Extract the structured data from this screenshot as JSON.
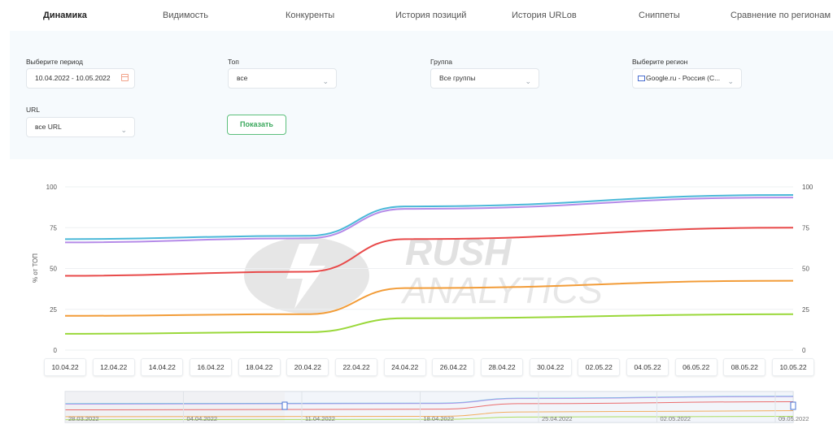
{
  "tabs": [
    {
      "label": "Динамика",
      "active": true
    },
    {
      "label": "Видимость"
    },
    {
      "label": "Конкуренты"
    },
    {
      "label": "История позиций"
    },
    {
      "label": "История URLов"
    },
    {
      "label": "Сниппеты"
    },
    {
      "label": "Сравнение по регионам"
    }
  ],
  "filters": {
    "period": {
      "label": "Выберите период",
      "value": "10.04.2022 - 10.05.2022"
    },
    "top": {
      "label": "Топ",
      "value": "все"
    },
    "group": {
      "label": "Группа",
      "value": "Все группы"
    },
    "region": {
      "label": "Выберите регион",
      "value": "Google.ru - Россия (С..."
    },
    "url": {
      "label": "URL",
      "value": "все URL"
    },
    "show_button": "Показать"
  },
  "watermark": {
    "line1": "RUSH",
    "line2": "ANALYTICS"
  },
  "chart_data": {
    "type": "line",
    "ylabel": "% от ТОП",
    "ylim": [
      0,
      100
    ],
    "yticks": [
      0,
      25,
      50,
      75,
      100
    ],
    "x": [
      "10.04.22",
      "12.04.22",
      "14.04.22",
      "16.04.22",
      "18.04.22",
      "20.04.22",
      "22.04.22",
      "24.04.22",
      "26.04.22",
      "28.04.22",
      "30.04.22",
      "02.05.22",
      "04.05.22",
      "06.05.22",
      "08.05.22",
      "10.05.22"
    ],
    "series": [
      {
        "color": "#4ab8d8",
        "points": [
          [
            "10.04.22",
            68
          ],
          [
            "20.04.22",
            70
          ],
          [
            "24.04.22",
            88
          ],
          [
            "10.05.22",
            95
          ]
        ]
      },
      {
        "color": "#b58be8",
        "points": [
          [
            "10.04.22",
            66
          ],
          [
            "20.04.22",
            68.5
          ],
          [
            "24.04.22",
            86.5
          ],
          [
            "10.05.22",
            93.5
          ]
        ]
      },
      {
        "color": "#e84a4a",
        "points": [
          [
            "10.04.22",
            45.5
          ],
          [
            "20.04.22",
            48
          ],
          [
            "24.04.22",
            68
          ],
          [
            "10.05.22",
            75
          ]
        ]
      },
      {
        "color": "#f29c38",
        "points": [
          [
            "10.04.22",
            21
          ],
          [
            "20.04.22",
            22
          ],
          [
            "24.04.22",
            38
          ],
          [
            "10.05.22",
            42.5
          ]
        ]
      },
      {
        "color": "#9ad83a",
        "points": [
          [
            "10.04.22",
            10
          ],
          [
            "20.04.22",
            11
          ],
          [
            "24.04.22",
            19.5
          ],
          [
            "10.05.22",
            22
          ]
        ]
      }
    ]
  },
  "navigator": {
    "labels": [
      "28.03.2022",
      "04.04.2022",
      "11.04.2022",
      "18.04.2022",
      "25.04.2022",
      "02.05.2022",
      "09.05.2022"
    ]
  }
}
